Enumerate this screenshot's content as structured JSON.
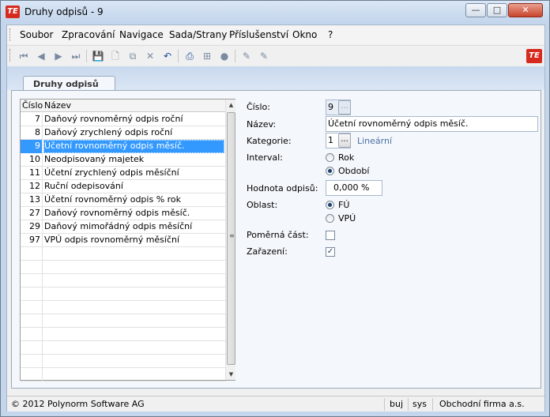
{
  "window": {
    "title": "Druhy odpisů - 9",
    "min": "—",
    "max": "□",
    "close": "✕",
    "logo": "TE"
  },
  "menu": [
    "Soubor",
    "Zpracování",
    "Navigace",
    "Sada/Strany",
    "Příslušenství",
    "Okno",
    "?"
  ],
  "toolbar": {
    "icons": [
      "first-icon",
      "prev-icon",
      "next-icon",
      "last-icon",
      "save-icon",
      "new-icon",
      "copy-icon",
      "delete-icon",
      "undo-icon",
      "print-icon",
      "tree-icon",
      "stop-icon",
      "edit-icon",
      "edit2-icon"
    ],
    "glyphs": [
      "⏮",
      "◀",
      "▶",
      "⏭",
      "💾",
      "🗋",
      "⧉",
      "✕",
      "↶",
      "⎙",
      "⊞",
      "●",
      "✎",
      "✎"
    ]
  },
  "tab": {
    "label": "Druhy odpisů"
  },
  "grid": {
    "headers": {
      "num": "Číslo",
      "name": "Název"
    },
    "rows": [
      {
        "num": "7",
        "name": "Daňový rovnoměrný odpis roční"
      },
      {
        "num": "8",
        "name": "Daňový zrychlený odpis roční"
      },
      {
        "num": "9",
        "name": "Účetní rovnoměrný odpis měsíč."
      },
      {
        "num": "10",
        "name": "Neodpisovaný majetek"
      },
      {
        "num": "11",
        "name": "Účetní zrychlený odpis měsíční"
      },
      {
        "num": "12",
        "name": "Ruční odepisování"
      },
      {
        "num": "13",
        "name": "Účetní rovnoměrný odpis % rok"
      },
      {
        "num": "27",
        "name": "Daňový rovnoměrný odpis měsíč."
      },
      {
        "num": "29",
        "name": "Daňový mimořádný odpis měsíční"
      },
      {
        "num": "97",
        "name": "VPÚ odpis rovnoměrný měsíční"
      }
    ],
    "selected_index": 2,
    "empty_rows": 10,
    "scroll_up": "▲",
    "scroll_down": "▼",
    "grip": "≡"
  },
  "form": {
    "cislo": {
      "label": "Číslo:",
      "value": "9",
      "dots": "..."
    },
    "nazev": {
      "label": "Název:",
      "value": "Účetní rovnoměrný odpis měsíč."
    },
    "kategorie": {
      "label": "Kategorie:",
      "value": "1",
      "dots": "...",
      "text": "Lineární"
    },
    "interval": {
      "label": "Interval:",
      "opt1": "Rok",
      "opt2": "Období",
      "selected": "Období"
    },
    "hodnota": {
      "label": "Hodnota odpisů:",
      "value": "0,000 %"
    },
    "oblast": {
      "label": "Oblast:",
      "opt1": "FÚ",
      "opt2": "VPÚ",
      "selected": "FÚ"
    },
    "pomerna": {
      "label": "Poměrná část:",
      "checked": false
    },
    "zarazeni": {
      "label": "Zařazení:",
      "checked": true,
      "mark": "✓"
    }
  },
  "status": {
    "copyright": "© 2012 Polynorm Software AG",
    "user": "buj",
    "db": "sys",
    "firm": "Obchodní firma a.s."
  },
  "colors": {
    "selection": "#3399ff",
    "accent": "#d62a1f",
    "frame": "#c4d6ec"
  }
}
